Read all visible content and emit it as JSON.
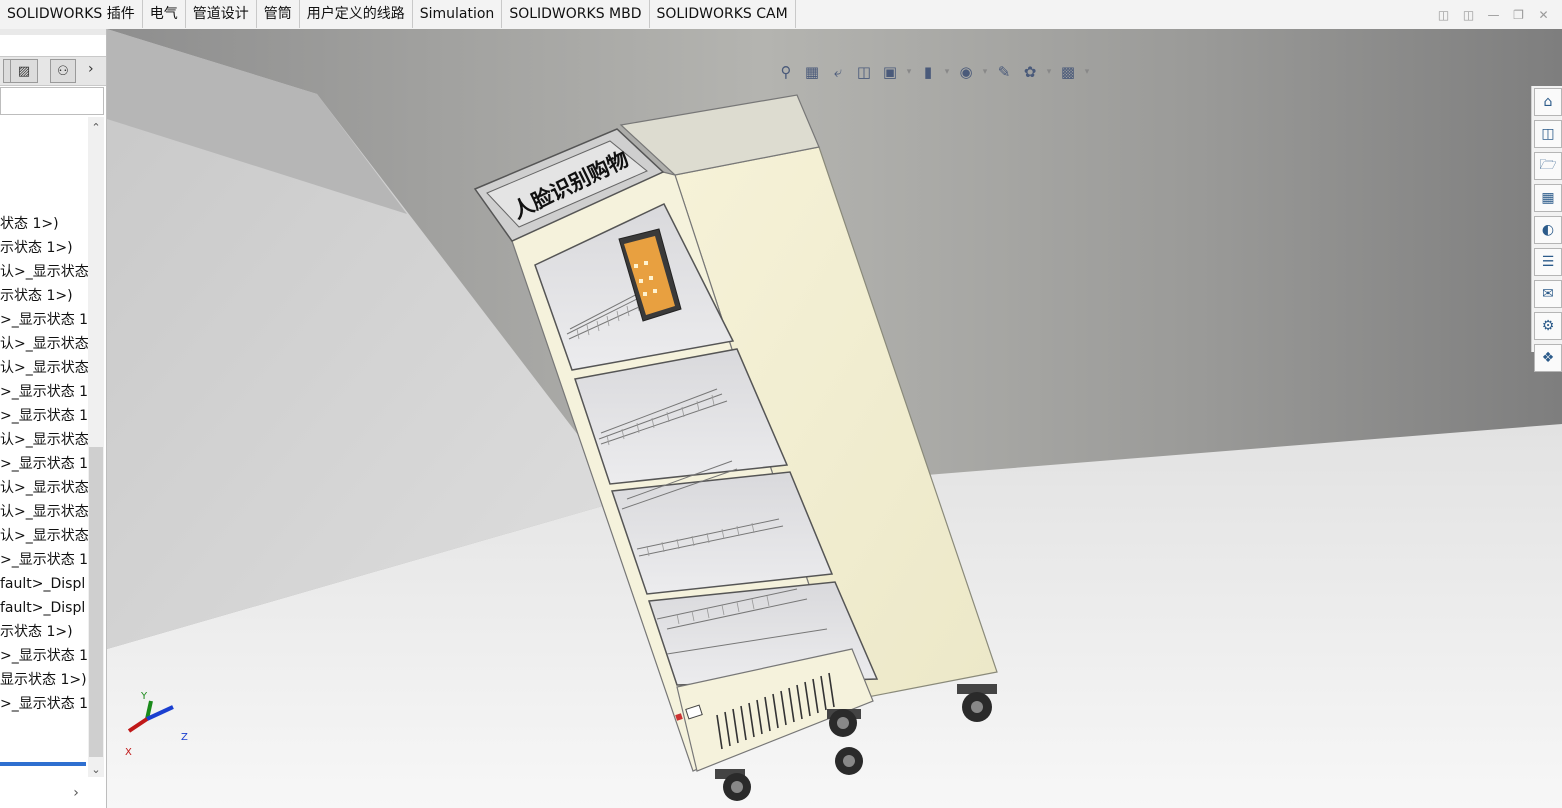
{
  "tabs": [
    "SOLIDWORKS 插件",
    "电气",
    "管道设计",
    "管筒",
    "用户定义的线路",
    "Simulation",
    "SOLIDWORKS MBD",
    "SOLIDWORKS CAM"
  ],
  "tree_items": [
    "状态 1>)",
    "示状态 1>)",
    "认>_显示状态",
    "示状态 1>)",
    ">_显示状态 1",
    "认>_显示状态",
    "认>_显示状态",
    ">_显示状态 1",
    ">_显示状态 1",
    "认>_显示状态",
    ">_显示状态 1",
    "认>_显示状态",
    "认>_显示状态",
    "认>_显示状态",
    ">_显示状态 1",
    "fault>_Displ",
    "fault>_Displ",
    "示状态 1>)",
    ">_显示状态 1",
    "显示状态 1>)",
    ">_显示状态 1"
  ],
  "model": {
    "sign_text": "人脸识别购物"
  },
  "triad": {
    "y": "Y",
    "z": "Z",
    "x": "X"
  },
  "colors": {
    "cabinet_body": "#f4f0d2",
    "sign_plate": "#dcdcdc",
    "floor": "#f0f0f0",
    "triad_y": "#1a8a1a",
    "triad_z": "#1a3fd0",
    "triad_x": "#c01818"
  }
}
